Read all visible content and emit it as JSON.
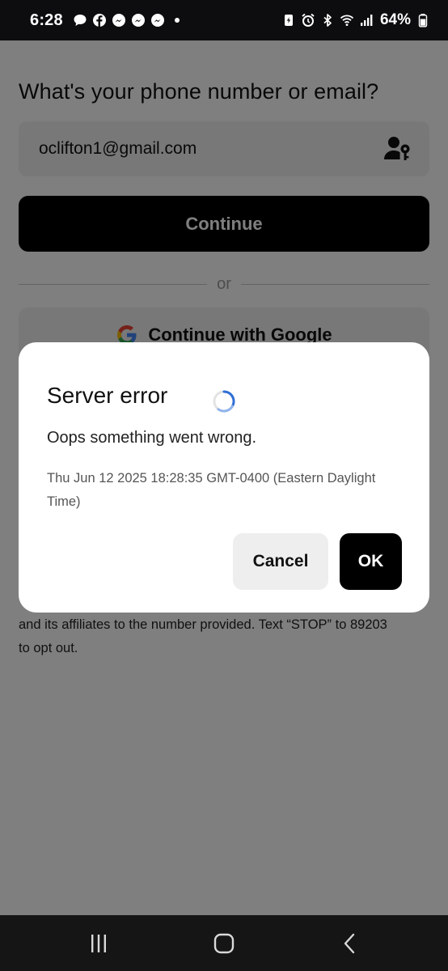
{
  "status_bar": {
    "time": "6:28",
    "notification_icons": [
      "chat-bubble-icon",
      "facebook-icon",
      "messenger-icon",
      "messenger-icon",
      "messenger-icon",
      "dot-icon"
    ],
    "system_icons": [
      "battery-saver-icon",
      "alarm-icon",
      "bluetooth-icon",
      "wifi-icon",
      "signal-icon"
    ],
    "battery_percent": "64%"
  },
  "login": {
    "heading": "What's your phone number or email?",
    "email_value": "oclifton1@gmail.com",
    "continue_label": "Continue",
    "divider_text": "or",
    "google_label": "Continue with Google",
    "disclaimer_line1": "and its affiliates to the number provided. Text “STOP” to 89203",
    "disclaimer_line2": "to opt out."
  },
  "dialog": {
    "title": "Server error",
    "message": "Oops something went wrong.",
    "timestamp": "Thu Jun 12 2025 18:28:35 GMT-0400 (Eastern Daylight Time)",
    "cancel_label": "Cancel",
    "ok_label": "OK"
  },
  "nav_bar": {
    "buttons": [
      "recents-icon",
      "home-icon",
      "back-icon"
    ]
  },
  "colors": {
    "primary_button": "#000000",
    "overlay": "rgba(0,0,0,0.5)",
    "spinner": "#2f6fd6"
  }
}
